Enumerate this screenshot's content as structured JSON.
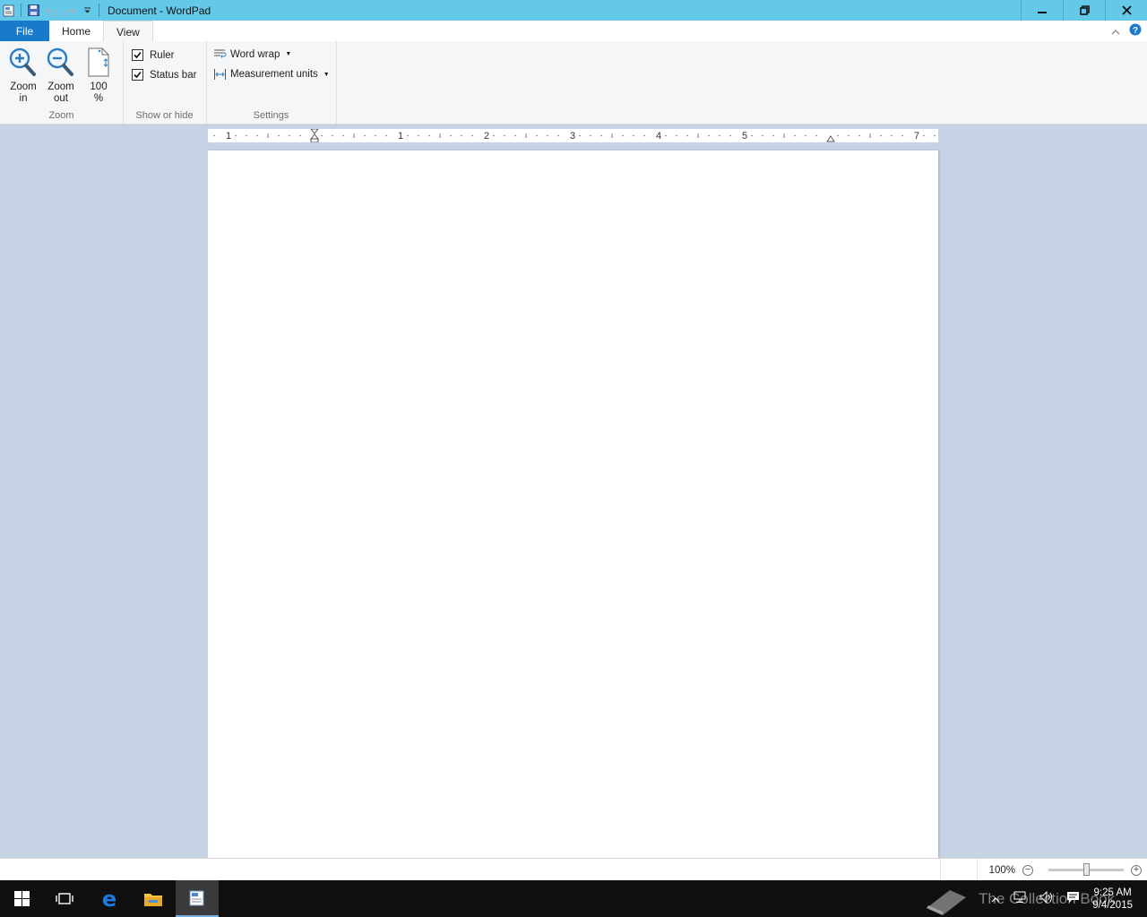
{
  "window": {
    "title": "Document - WordPad"
  },
  "tabs": {
    "file": "File",
    "home": "Home",
    "view": "View"
  },
  "ribbon": {
    "zoom_group": {
      "label": "Zoom",
      "zoom_in_line1": "Zoom",
      "zoom_in_line2": "in",
      "zoom_out_line1": "Zoom",
      "zoom_out_line2": "out",
      "zoom_100_line1": "100",
      "zoom_100_line2": "%"
    },
    "show_hide_group": {
      "label": "Show or hide",
      "ruler": "Ruler",
      "ruler_checked": true,
      "status_bar": "Status bar",
      "status_bar_checked": true
    },
    "settings_group": {
      "label": "Settings",
      "word_wrap": "Word wrap",
      "measurement_units": "Measurement units"
    }
  },
  "ruler": {
    "numbers": [
      "1",
      "1",
      "2",
      "3",
      "4",
      "5",
      "7"
    ]
  },
  "statusbar": {
    "zoom_percent": "100%",
    "zoom_level": 0.5,
    "zoom_out_symbol": "−",
    "zoom_in_symbol": "+"
  },
  "taskbar": {
    "time": "9:25 AM",
    "date": "9/4/2015",
    "watermark": "The Collection Book"
  },
  "colors": {
    "titlebar": "#64c8e8",
    "file_tab": "#1979ca",
    "workspace": "#c6d3e4",
    "taskbar": "#101010"
  }
}
